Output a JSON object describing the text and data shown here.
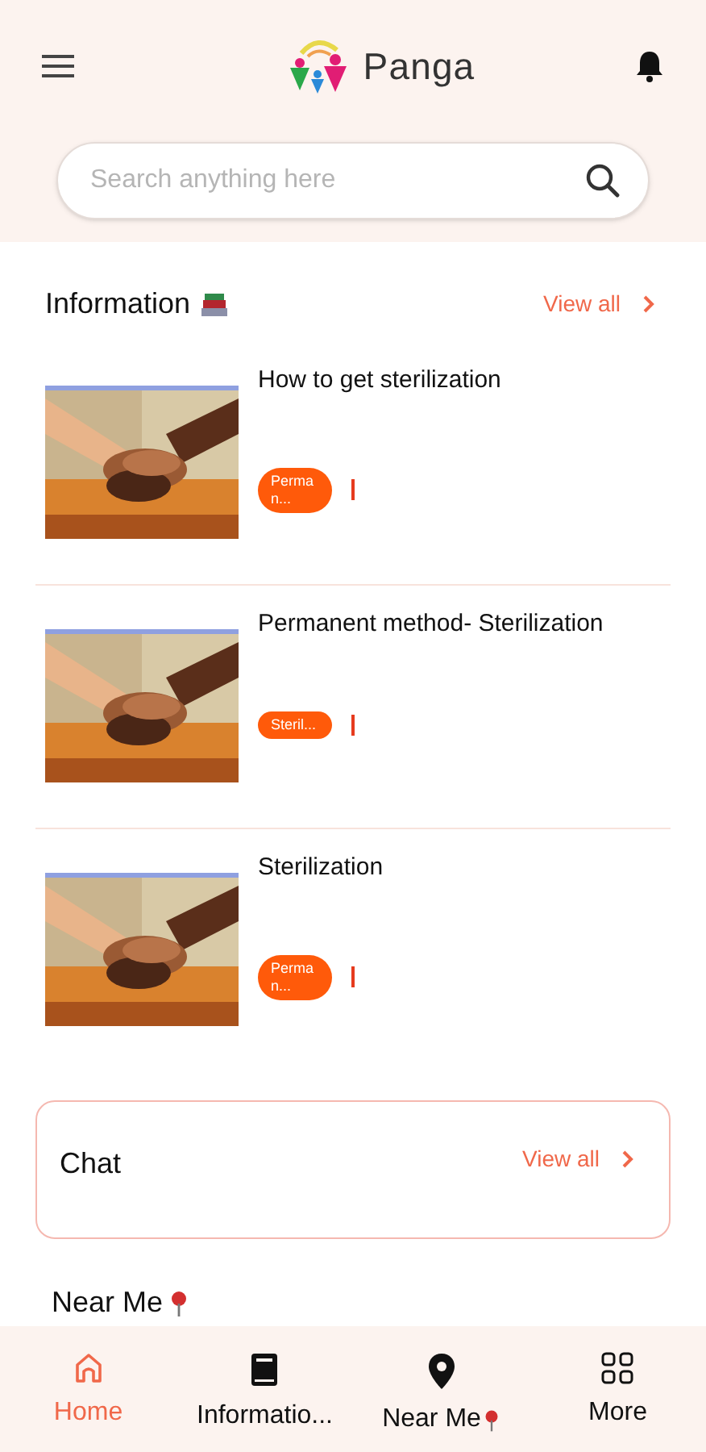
{
  "app_bar": {
    "title": "Panga"
  },
  "search": {
    "placeholder": "Search anything here"
  },
  "information": {
    "title": "Information",
    "view_all": "View all",
    "items": [
      {
        "title": "How to get sterilization",
        "tag": "Perman..."
      },
      {
        "title": "Permanent method- Sterilization",
        "tag": "Steril..."
      },
      {
        "title": "Sterilization",
        "tag": "Perman..."
      }
    ]
  },
  "chat": {
    "title": "Chat",
    "view_all": "View all"
  },
  "near_me": {
    "title": "Near Me"
  },
  "bottom_nav": [
    {
      "label": "Home",
      "kind": "home",
      "selected": true
    },
    {
      "label": "Informatio...",
      "kind": "book",
      "selected": false
    },
    {
      "label": "Near Me",
      "kind": "pin",
      "selected": false
    },
    {
      "label": "More",
      "kind": "grid",
      "selected": false
    }
  ]
}
